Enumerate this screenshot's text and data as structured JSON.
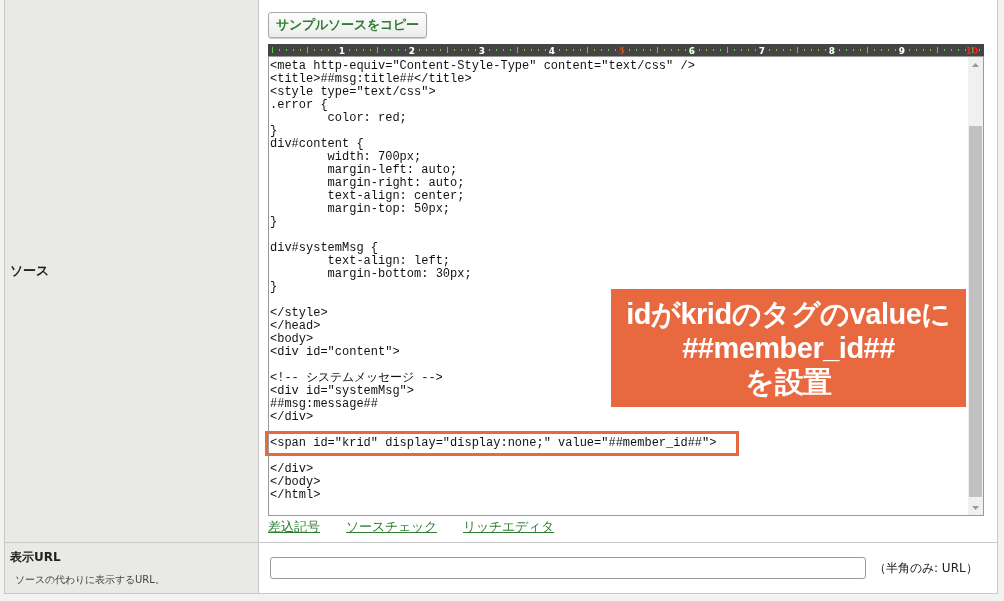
{
  "source_row": {
    "label": "ソース",
    "copy_button": "サンプルソースをコピー",
    "ruler": [
      {
        "label": "1",
        "color": "#ffffff"
      },
      {
        "label": "2",
        "color": "#ffffff"
      },
      {
        "label": "3",
        "color": "#ffffff"
      },
      {
        "label": "4",
        "color": "#ffffff"
      },
      {
        "label": "5",
        "color": "#ff2020"
      },
      {
        "label": "6",
        "color": "#ffffff"
      },
      {
        "label": "7",
        "color": "#ffffff"
      },
      {
        "label": "8",
        "color": "#ffffff"
      },
      {
        "label": "9",
        "color": "#ffffff"
      },
      {
        "label": "10",
        "color": "#ff2020"
      }
    ],
    "code_lines": [
      {
        "kind": "code",
        "text": "<meta http-equiv=\"Content-Style-Type\" content=\"text/css\" />",
        "highlighted": false
      },
      {
        "kind": "code",
        "text": "<title>##msg:title##</title>",
        "highlighted": false
      },
      {
        "kind": "code",
        "text": "<style type=\"text/css\">",
        "highlighted": false
      },
      {
        "kind": "code",
        "text": ".error {",
        "highlighted": false
      },
      {
        "kind": "code",
        "text": "        color: red;",
        "highlighted": false
      },
      {
        "kind": "code",
        "text": "}",
        "highlighted": false
      },
      {
        "kind": "code",
        "text": "div#content {",
        "highlighted": false
      },
      {
        "kind": "code",
        "text": "        width: 700px;",
        "highlighted": false
      },
      {
        "kind": "code",
        "text": "        margin-left: auto;",
        "highlighted": false
      },
      {
        "kind": "code",
        "text": "        margin-right: auto;",
        "highlighted": false
      },
      {
        "kind": "code",
        "text": "        text-align: center;",
        "highlighted": false
      },
      {
        "kind": "code",
        "text": "        margin-top: 50px;",
        "highlighted": false
      },
      {
        "kind": "code",
        "text": "}",
        "highlighted": false
      },
      {
        "kind": "blank"
      },
      {
        "kind": "code",
        "text": "div#systemMsg {",
        "highlighted": false
      },
      {
        "kind": "code",
        "text": "        text-align: left;",
        "highlighted": false
      },
      {
        "kind": "code",
        "text": "        margin-bottom: 30px;",
        "highlighted": false
      },
      {
        "kind": "code",
        "text": "}",
        "highlighted": false
      },
      {
        "kind": "blank"
      },
      {
        "kind": "code",
        "text": "</style>",
        "highlighted": false
      },
      {
        "kind": "code",
        "text": "</head>",
        "highlighted": false
      },
      {
        "kind": "code",
        "text": "<body>",
        "highlighted": false
      },
      {
        "kind": "code",
        "text": "<div id=\"content\">",
        "highlighted": false
      },
      {
        "kind": "blank"
      },
      {
        "kind": "code",
        "text": "<!-- システムメッセージ -->",
        "highlighted": false
      },
      {
        "kind": "code",
        "text": "<div id=\"systemMsg\">",
        "highlighted": false
      },
      {
        "kind": "code",
        "text": "##msg:message##",
        "highlighted": false
      },
      {
        "kind": "code",
        "text": "</div>",
        "highlighted": false
      },
      {
        "kind": "blank"
      },
      {
        "kind": "code",
        "text": "<span id=\"krid\" display=\"display:none;\" value=\"##member_id##\">",
        "highlighted": true
      },
      {
        "kind": "blank"
      },
      {
        "kind": "code",
        "text": "</div>",
        "highlighted": false
      },
      {
        "kind": "code",
        "text": "</body>",
        "highlighted": false
      },
      {
        "kind": "code",
        "text": "</html>",
        "highlighted": false
      }
    ],
    "links": [
      "差込記号",
      "ソースチェック",
      "リッチエディタ"
    ]
  },
  "callout": {
    "lines": [
      "idがkridのタグのvalueに",
      "##member_id##",
      "を設置"
    ]
  },
  "url_row": {
    "label": "表示URL",
    "hint": "ソースの代わりに表示するURL。",
    "note": "（半角のみ: URL）"
  }
}
